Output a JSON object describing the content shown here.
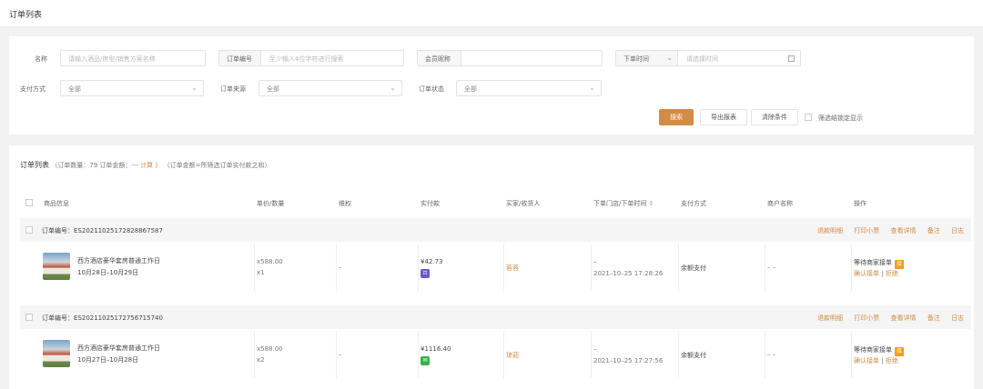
{
  "page": {
    "title": "订单列表"
  },
  "filters": {
    "name_label": "名称",
    "name_placeholder": "请输入酒品/房型/销售方案名称",
    "order_no_prefix": "订单编号",
    "order_no_placeholder": "至少输入4位字符进行搜索",
    "member_prefix": "会员昵称",
    "member_value": "",
    "time_prefix": "下单时间",
    "time_placeholder": "请选择时间",
    "pay_method_label": "支付方式",
    "pay_method_value": "全部",
    "order_source_label": "订单来源",
    "order_source_value": "全部",
    "order_status_label": "订单状态",
    "order_status_value": "全部"
  },
  "actions": {
    "search": "搜索",
    "export": "导出报表",
    "clear": "清除条件",
    "filter_locked": "筛选结锁定显示"
  },
  "summary": {
    "title": "订单列表",
    "count_text": "（订单数量：79  订单金额：---",
    "calc": "计算",
    "close_paren": "）",
    "note": "（订单金额=所筛选订单实付款之和）"
  },
  "columns": [
    "商品信息",
    "单价/数量",
    "维权",
    "实付款",
    "买家/收货人",
    "下单门店/下单时间",
    "支付方式",
    "商户名称",
    "操作"
  ],
  "sort_icon": "sort-icon",
  "orders": [
    {
      "order_no": "订单编号：ES20211025172828867587",
      "actions": [
        "退款明细",
        "打印小票",
        "查看详情",
        "备注",
        "日志"
      ],
      "product_name": "西方酒店豪华套房普通工作日",
      "product_dates": "10月28日–10月29日",
      "unit_price": "x588.00",
      "qty": "x1",
      "rights": "–",
      "paid": "¥42.73",
      "pay_icon": "card-icon",
      "buyer": "蓉蓉",
      "store": "–",
      "order_time": "2021–10–25 17:28:26",
      "pay_method": "余额支付",
      "merchant": "– –",
      "status": "等待商家接单",
      "status_badge": "接",
      "confirm": "确认接单",
      "sep": "|",
      "reject": "拒绝"
    },
    {
      "order_no": "订单编号：ES20211025172756715740",
      "actions": [
        "退款明细",
        "打印小票",
        "查看详情",
        "备注",
        "日志"
      ],
      "product_name": "西方酒店豪华套房普通工作日",
      "product_dates": "10月27日–10月28日",
      "unit_price": "x588.00",
      "qty": "x2",
      "rights": "–",
      "paid": "¥1116.40",
      "pay_icon": "wechat-icon",
      "buyer": "琼茹",
      "store": "–",
      "order_time": "2021–10–25 17:27:56",
      "pay_method": "余额支付",
      "merchant": "– –",
      "status": "等待商家接单",
      "status_badge": "接",
      "confirm": "确认接单",
      "sep": "|",
      "reject": "拒绝"
    }
  ],
  "colors": {
    "accent": "#d38b45",
    "card_pay": "#6a5acd",
    "wechat_pay": "#36b34a",
    "badge": "#f39c1e"
  }
}
